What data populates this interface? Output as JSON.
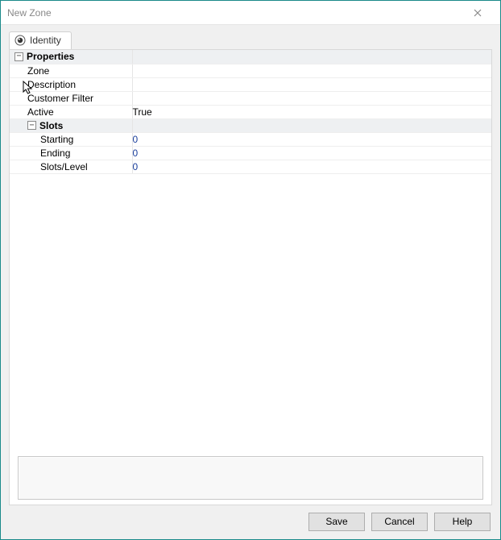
{
  "window": {
    "title": "New Zone"
  },
  "tabs": {
    "identity": "Identity"
  },
  "sections": {
    "properties": {
      "title": "Properties",
      "rows": {
        "zone": {
          "label": "Zone",
          "value": ""
        },
        "description": {
          "label": "Description",
          "value": ""
        },
        "customer_filter": {
          "label": "Customer Filter",
          "value": ""
        },
        "active": {
          "label": "Active",
          "value": "True"
        }
      }
    },
    "slots": {
      "title": "Slots",
      "rows": {
        "starting": {
          "label": "Starting",
          "value": "0"
        },
        "ending": {
          "label": "Ending",
          "value": "0"
        },
        "slots_level": {
          "label": "Slots/Level",
          "value": "0"
        }
      }
    }
  },
  "buttons": {
    "save": "Save",
    "cancel": "Cancel",
    "help": "Help"
  }
}
